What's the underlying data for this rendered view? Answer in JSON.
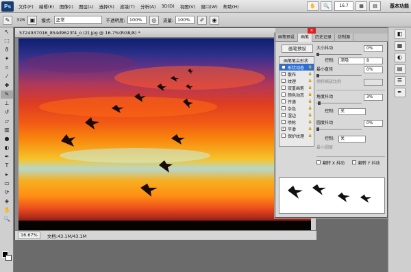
{
  "menubar": {
    "logo": "Ps",
    "items": [
      "文件(F)",
      "编辑(E)",
      "图像(I)",
      "图层(L)",
      "选择(S)",
      "滤镜(T)",
      "分析(A)",
      "3D(D)",
      "视图(V)",
      "窗口(W)",
      "帮助(H)"
    ],
    "zoom": "16.7",
    "workspace": "基本功能"
  },
  "options": {
    "size": "326",
    "mode_label": "模式:",
    "mode_value": "正常",
    "opacity_label": "不透明度:",
    "opacity_value": "100%",
    "flow_label": "流量:",
    "flow_value": "100%"
  },
  "document": {
    "title": "5724937016_854d9623f4_o (2).jpg @ 16.7%(RGB/8) *",
    "zoom": "16.67%",
    "docinfo": "文档:43.1M/43.1M"
  },
  "panel": {
    "tabs": [
      "画笔预设",
      "画笔",
      "历史记录",
      "仿制源"
    ],
    "presets_button": "画笔预设",
    "brush_items": [
      {
        "label": "画笔笔尖形状",
        "checked": false,
        "head": true
      },
      {
        "label": "形状动态",
        "checked": true,
        "sel": true
      },
      {
        "label": "散布",
        "checked": false
      },
      {
        "label": "纹理",
        "checked": false
      },
      {
        "label": "双重画笔",
        "checked": false
      },
      {
        "label": "颜色动态",
        "checked": false
      },
      {
        "label": "传递",
        "checked": false
      },
      {
        "label": "杂色",
        "checked": false
      },
      {
        "label": "湿边",
        "checked": false
      },
      {
        "label": "喷枪",
        "checked": false
      },
      {
        "label": "平滑",
        "checked": true
      },
      {
        "label": "保护纹理",
        "checked": false
      }
    ],
    "size_jitter_label": "大小抖动",
    "size_jitter": "0%",
    "control_label": "控制:",
    "control_fade": "渐隐",
    "control_fade_val": "8",
    "min_diameter_label": "最小直径",
    "min_diameter": "0%",
    "tilt_scale_label": "倾斜缩放比例",
    "angle_jitter_label": "角度抖动",
    "angle_jitter": "3%",
    "control_off": "关",
    "roundness_jitter_label": "圆度抖动",
    "roundness_jitter": "0%",
    "min_roundness_label": "最小圆度",
    "flip_x": "翻转 X 抖动",
    "flip_y": "翻转 Y 抖动"
  }
}
